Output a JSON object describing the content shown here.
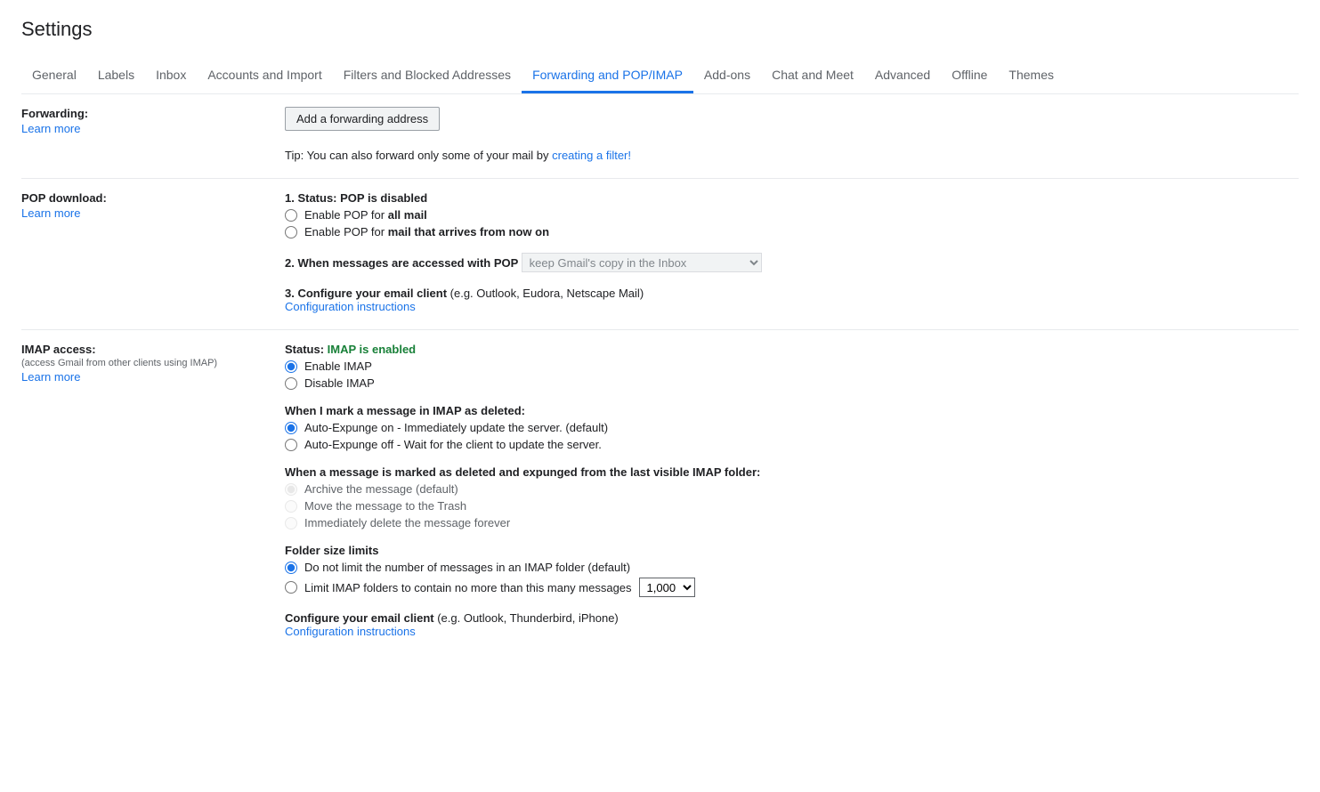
{
  "page": {
    "title": "Settings"
  },
  "tabs": [
    {
      "label": "General"
    },
    {
      "label": "Labels"
    },
    {
      "label": "Inbox"
    },
    {
      "label": "Accounts and Import"
    },
    {
      "label": "Filters and Blocked Addresses"
    },
    {
      "label": "Forwarding and POP/IMAP",
      "active": true
    },
    {
      "label": "Add-ons"
    },
    {
      "label": "Chat and Meet"
    },
    {
      "label": "Advanced"
    },
    {
      "label": "Offline"
    },
    {
      "label": "Themes"
    }
  ],
  "forwarding": {
    "label": "Forwarding:",
    "learn_more": "Learn more",
    "button": "Add a forwarding address",
    "tip_prefix": "Tip: You can also forward only some of your mail by ",
    "tip_link": "creating a filter!"
  },
  "pop": {
    "label": "POP download:",
    "learn_more": "Learn more",
    "status_prefix": "1. Status: ",
    "status_value": "POP is disabled",
    "opt1_prefix": "Enable POP for ",
    "opt1_bold": "all mail",
    "opt2_prefix": "Enable POP for ",
    "opt2_bold": "mail that arrives from now on",
    "access_heading": "2. When messages are accessed with POP ",
    "select_value": "keep Gmail's copy in the Inbox",
    "configure_heading": "3. Configure your email client ",
    "configure_paren": "(e.g. Outlook, Eudora, Netscape Mail)",
    "config_link": "Configuration instructions"
  },
  "imap": {
    "label": "IMAP access:",
    "sublabel": "(access Gmail from other clients using IMAP)",
    "learn_more": "Learn more",
    "status_prefix": "Status: ",
    "status_value": "IMAP is enabled",
    "opt_enable": "Enable IMAP",
    "opt_disable": "Disable IMAP",
    "deleted_heading": "When I mark a message in IMAP as deleted:",
    "expunge_on": "Auto-Expunge on - Immediately update the server. (default)",
    "expunge_off": "Auto-Expunge off - Wait for the client to update the server.",
    "expunged_heading": "When a message is marked as deleted and expunged from the last visible IMAP folder:",
    "archive": "Archive the message (default)",
    "trash": "Move the message to the Trash",
    "delete_forever": "Immediately delete the message forever",
    "folder_heading": "Folder size limits",
    "no_limit": "Do not limit the number of messages in an IMAP folder (default)",
    "limit_prefix": "Limit IMAP folders to contain no more than this many messages ",
    "limit_select": "1,000",
    "configure_heading": "Configure your email client ",
    "configure_paren": "(e.g. Outlook, Thunderbird, iPhone)",
    "config_link": "Configuration instructions"
  }
}
